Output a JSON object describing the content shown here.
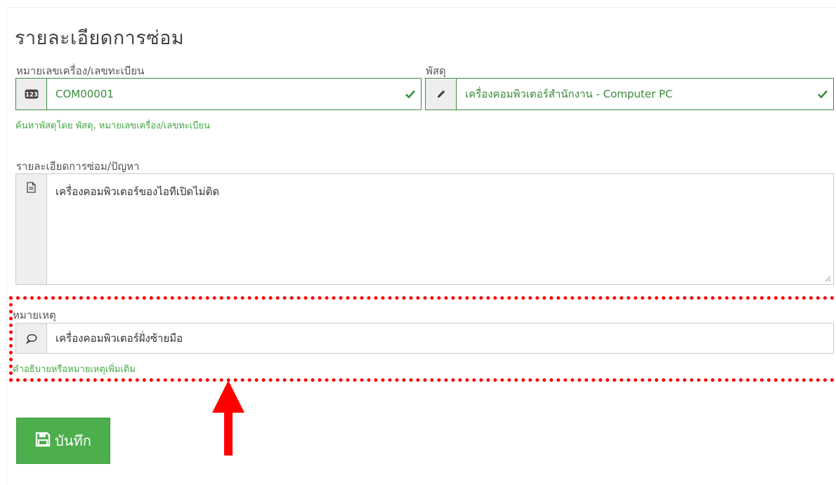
{
  "page": {
    "title": "รายละเอียดการซ่อม"
  },
  "machine_no": {
    "label": "หมายเลขเครื่อง/เลขทะเบียน",
    "value": "COM00001",
    "icon": "number-icon",
    "help": "ค้นหาพัสดุโดย พัสดุ, หมายเลขเครื่อง/เลขทะเบียน"
  },
  "item": {
    "label": "พัสดุ",
    "value": "เครื่องคอมพิวเตอร์สำนักงาน - Computer PC",
    "icon": "pencil-icon"
  },
  "detail": {
    "label": "รายละเอียดการซ่อม/ปัญหา",
    "value": "เครื่องคอมพิวเตอร์ของไอทีเปิดไม่ติด",
    "icon": "document-icon"
  },
  "note": {
    "label": "หมายเหตุ",
    "value": "เครื่องคอมพิวเตอร์ฝั่งซ้ายมือ",
    "icon": "comment-icon",
    "help": "คำอธิบายหรือหมายเหตุเพิ่มเติม"
  },
  "save_button": {
    "label": "บันทึก",
    "icon": "save-icon"
  },
  "colors": {
    "success": "#3c8d3c",
    "button": "#4cae4c",
    "highlight": "#ff0000"
  }
}
